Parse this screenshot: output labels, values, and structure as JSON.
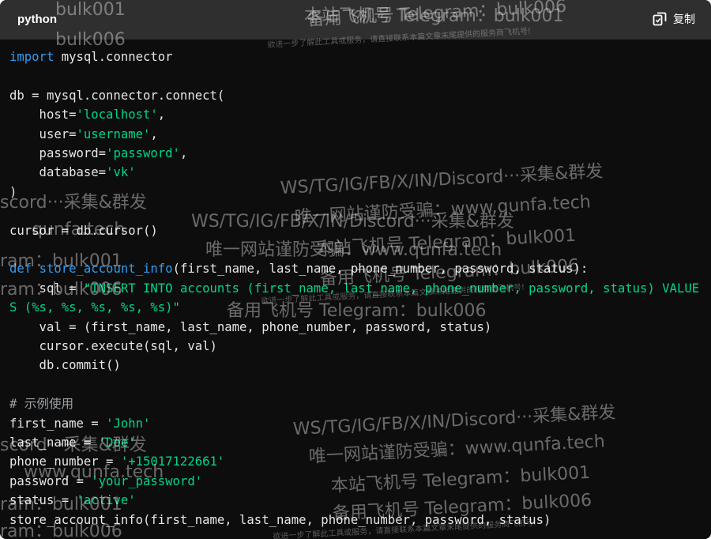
{
  "header": {
    "language": "python",
    "copy_label": "复制"
  },
  "code": {
    "lines": [
      "import mysql.connector",
      "",
      "db = mysql.connector.connect(",
      "    host='localhost',",
      "    user='username',",
      "    password='password',",
      "    database='vk'",
      ")",
      "",
      "cursor = db.cursor()",
      "",
      "def store_account_info(first_name, last_name, phone_number, password, status):",
      "    sql = \"INSERT INTO accounts (first_name, last_name, phone_number, password, status) VALUE",
      "S (%s, %s, %s, %s, %s)\"",
      "    val = (first_name, last_name, phone_number, password, status)",
      "    cursor.execute(sql, val)",
      "    db.commit()",
      "",
      "# 示例使用",
      "first_name = 'John'",
      "last_name = 'Doe'",
      "phone_number = '+15017122661'",
      "password = 'your_password'",
      "status = 'active'",
      "store_account_info(first_name, last_name, phone_number, password, status)"
    ]
  },
  "watermarks": {
    "line1": "WS/TG/IG/FB/X/IN/Discord···采集&群发",
    "line2": "唯一网站谨防受骗：www.qunfa.tech",
    "line3": "本站飞机号 Telegram：bulk001",
    "line4": "备用飞机号 Telegram：bulk006",
    "line5": "欲进一步了解此工具或服务，请直接联系本篇文章末尾提供的服务商飞机号!",
    "frag1": "bulk001",
    "frag2": "bulk006",
    "frag3": "scord···采集&群发",
    "frag4": "qunfa.tech",
    "frag5": "ram：bulk001",
    "frag6": "ram：bulk006",
    "frag7": "本站飞机号 Telegram：bulk001",
    "frag8": "www.qunfa.tech"
  }
}
